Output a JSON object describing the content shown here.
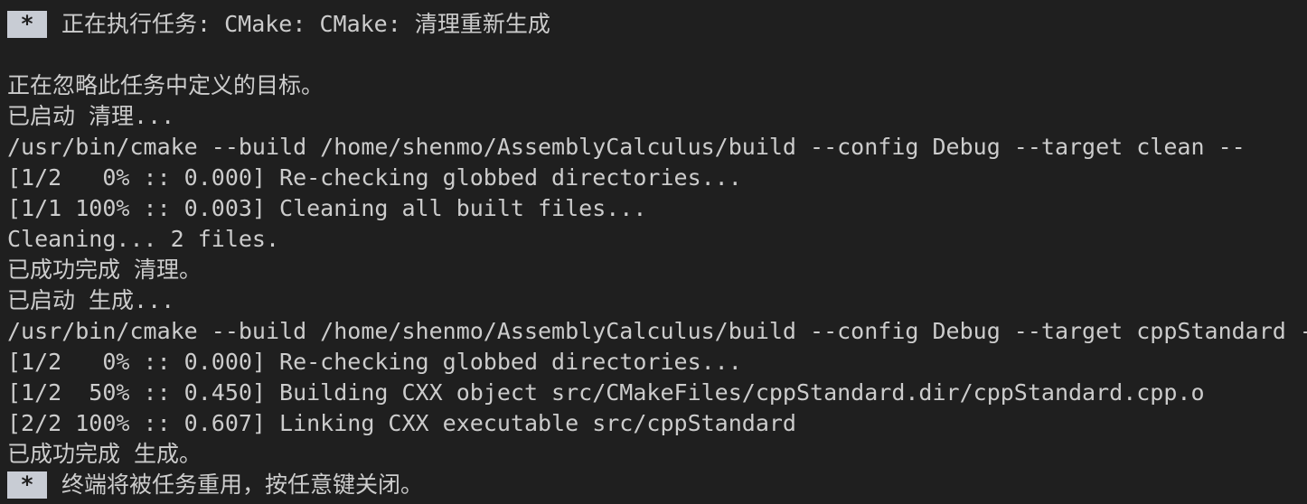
{
  "terminal": {
    "task_marker": " * ",
    "task_header": "正在执行任务: CMake: CMake: 清理重新生成",
    "lines": [
      "正在忽略此任务中定义的目标。",
      "已启动 清理...",
      "/usr/bin/cmake --build /home/shenmo/AssemblyCalculus/build --config Debug --target clean --",
      "[1/2   0% :: 0.000] Re-checking globbed directories...",
      "[1/1 100% :: 0.003] Cleaning all built files...",
      "Cleaning... 2 files.",
      "已成功完成 清理。",
      "已启动 生成...",
      "/usr/bin/cmake --build /home/shenmo/AssemblyCalculus/build --config Debug --target cppStandard -",
      "[1/2   0% :: 0.000] Re-checking globbed directories...",
      "[1/2  50% :: 0.450] Building CXX object src/CMakeFiles/cppStandard.dir/cppStandard.cpp.o",
      "[2/2 100% :: 0.607] Linking CXX executable src/cppStandard",
      "已成功完成 生成。"
    ],
    "footer_marker": " * ",
    "footer_text": "终端将被任务重用，按任意键关闭。"
  }
}
